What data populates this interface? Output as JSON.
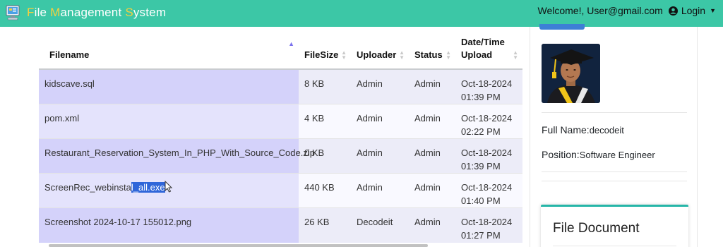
{
  "navbar": {
    "brand": {
      "p1": "F",
      "p2": "ile ",
      "p3": "M",
      "p4": "anagement ",
      "p5": "S",
      "p6": "ystem"
    },
    "welcome": "Welcome!, User@gmail.com",
    "login_label": "Login",
    "accent": "#3cc7a6"
  },
  "table": {
    "headers": {
      "filename": "Filename",
      "filesize": "FileSize",
      "uploader": "Uploader",
      "status": "Status",
      "datetime_1": "Date/Time",
      "datetime_2": "Upload"
    },
    "rows": [
      {
        "filename": "kidscave.sql",
        "filesize": "8 KB",
        "uploader": "Admin",
        "status": "Admin",
        "date": "Oct-18-2024",
        "time": "01:39 PM"
      },
      {
        "filename": "pom.xml",
        "filesize": "4 KB",
        "uploader": "Admin",
        "status": "Admin",
        "date": "Oct-18-2024",
        "time": "02:22 PM"
      },
      {
        "filename": "Restaurant_Reservation_System_In_PHP_With_Source_Code.zip",
        "filesize": "0 KB",
        "uploader": "Admin",
        "status": "Admin",
        "date": "Oct-18-2024",
        "time": "01:39 PM"
      },
      {
        "filename_plain": "ScreenRec_webinsta",
        "filename_selected": "l_all.exe",
        "filesize": "440 KB",
        "uploader": "Admin",
        "status": "Admin",
        "date": "Oct-18-2024",
        "time": "01:40 PM"
      },
      {
        "filename": "Screenshot 2024-10-17 155012.png",
        "filesize": "26 KB",
        "uploader": "Decodeit",
        "status": "Admin",
        "date": "Oct-18-2024",
        "time": "01:27 PM"
      }
    ]
  },
  "profile": {
    "fullname_label": "Full Name:",
    "fullname_value": "decodeit",
    "position_label": "Position:",
    "position_value": "Software Engineer"
  },
  "doc_card": {
    "title": "File Document"
  }
}
